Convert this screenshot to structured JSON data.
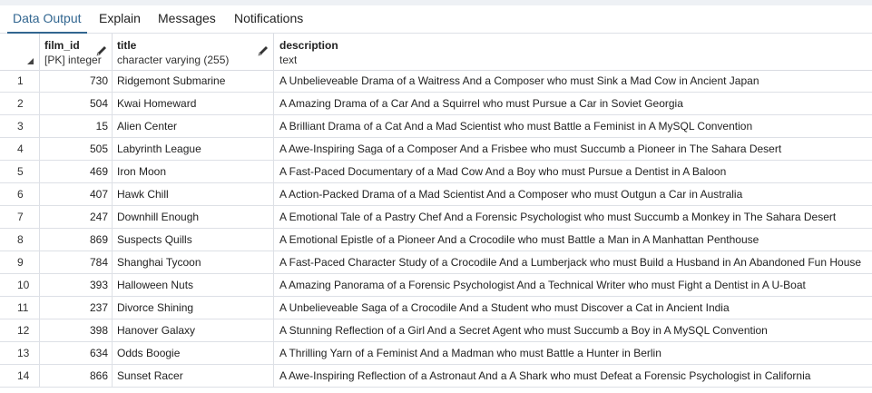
{
  "tabs": [
    {
      "label": "Data Output",
      "active": true
    },
    {
      "label": "Explain",
      "active": false
    },
    {
      "label": "Messages",
      "active": false
    },
    {
      "label": "Notifications",
      "active": false
    }
  ],
  "columns": [
    {
      "name": "film_id",
      "type": "[PK] integer"
    },
    {
      "name": "title",
      "type": "character varying (255)"
    },
    {
      "name": "description",
      "type": "text"
    }
  ],
  "rows": [
    {
      "n": "1",
      "film_id": "730",
      "title": "Ridgemont Submarine",
      "description": "A Unbelieveable Drama of a Waitress And a Composer who must Sink a Mad Cow in Ancient Japan"
    },
    {
      "n": "2",
      "film_id": "504",
      "title": "Kwai Homeward",
      "description": "A Amazing Drama of a Car And a Squirrel who must Pursue a Car in Soviet Georgia"
    },
    {
      "n": "3",
      "film_id": "15",
      "title": "Alien Center",
      "description": "A Brilliant Drama of a Cat And a Mad Scientist who must Battle a Feminist in A MySQL Convention"
    },
    {
      "n": "4",
      "film_id": "505",
      "title": "Labyrinth League",
      "description": "A Awe-Inspiring Saga of a Composer And a Frisbee who must Succumb a Pioneer in The Sahara Desert"
    },
    {
      "n": "5",
      "film_id": "469",
      "title": "Iron Moon",
      "description": "A Fast-Paced Documentary of a Mad Cow And a Boy who must Pursue a Dentist in A Baloon"
    },
    {
      "n": "6",
      "film_id": "407",
      "title": "Hawk Chill",
      "description": "A Action-Packed Drama of a Mad Scientist And a Composer who must Outgun a Car in Australia"
    },
    {
      "n": "7",
      "film_id": "247",
      "title": "Downhill Enough",
      "description": "A Emotional Tale of a Pastry Chef And a Forensic Psychologist who must Succumb a Monkey in The Sahara Desert"
    },
    {
      "n": "8",
      "film_id": "869",
      "title": "Suspects Quills",
      "description": "A Emotional Epistle of a Pioneer And a Crocodile who must Battle a Man in A Manhattan Penthouse"
    },
    {
      "n": "9",
      "film_id": "784",
      "title": "Shanghai Tycoon",
      "description": "A Fast-Paced Character Study of a Crocodile And a Lumberjack who must Build a Husband in An Abandoned Fun House"
    },
    {
      "n": "10",
      "film_id": "393",
      "title": "Halloween Nuts",
      "description": "A Amazing Panorama of a Forensic Psychologist And a Technical Writer who must Fight a Dentist in A U-Boat"
    },
    {
      "n": "11",
      "film_id": "237",
      "title": "Divorce Shining",
      "description": "A Unbelieveable Saga of a Crocodile And a Student who must Discover a Cat in Ancient India"
    },
    {
      "n": "12",
      "film_id": "398",
      "title": "Hanover Galaxy",
      "description": "A Stunning Reflection of a Girl And a Secret Agent who must Succumb a Boy in A MySQL Convention"
    },
    {
      "n": "13",
      "film_id": "634",
      "title": "Odds Boogie",
      "description": "A Thrilling Yarn of a Feminist And a Madman who must Battle a Hunter in Berlin"
    },
    {
      "n": "14",
      "film_id": "866",
      "title": "Sunset Racer",
      "description": "A Awe-Inspiring Reflection of a Astronaut And a A Shark who must Defeat a Forensic Psychologist in California"
    }
  ],
  "colors": {
    "accent": "#326690",
    "border": "#dde0e6"
  }
}
